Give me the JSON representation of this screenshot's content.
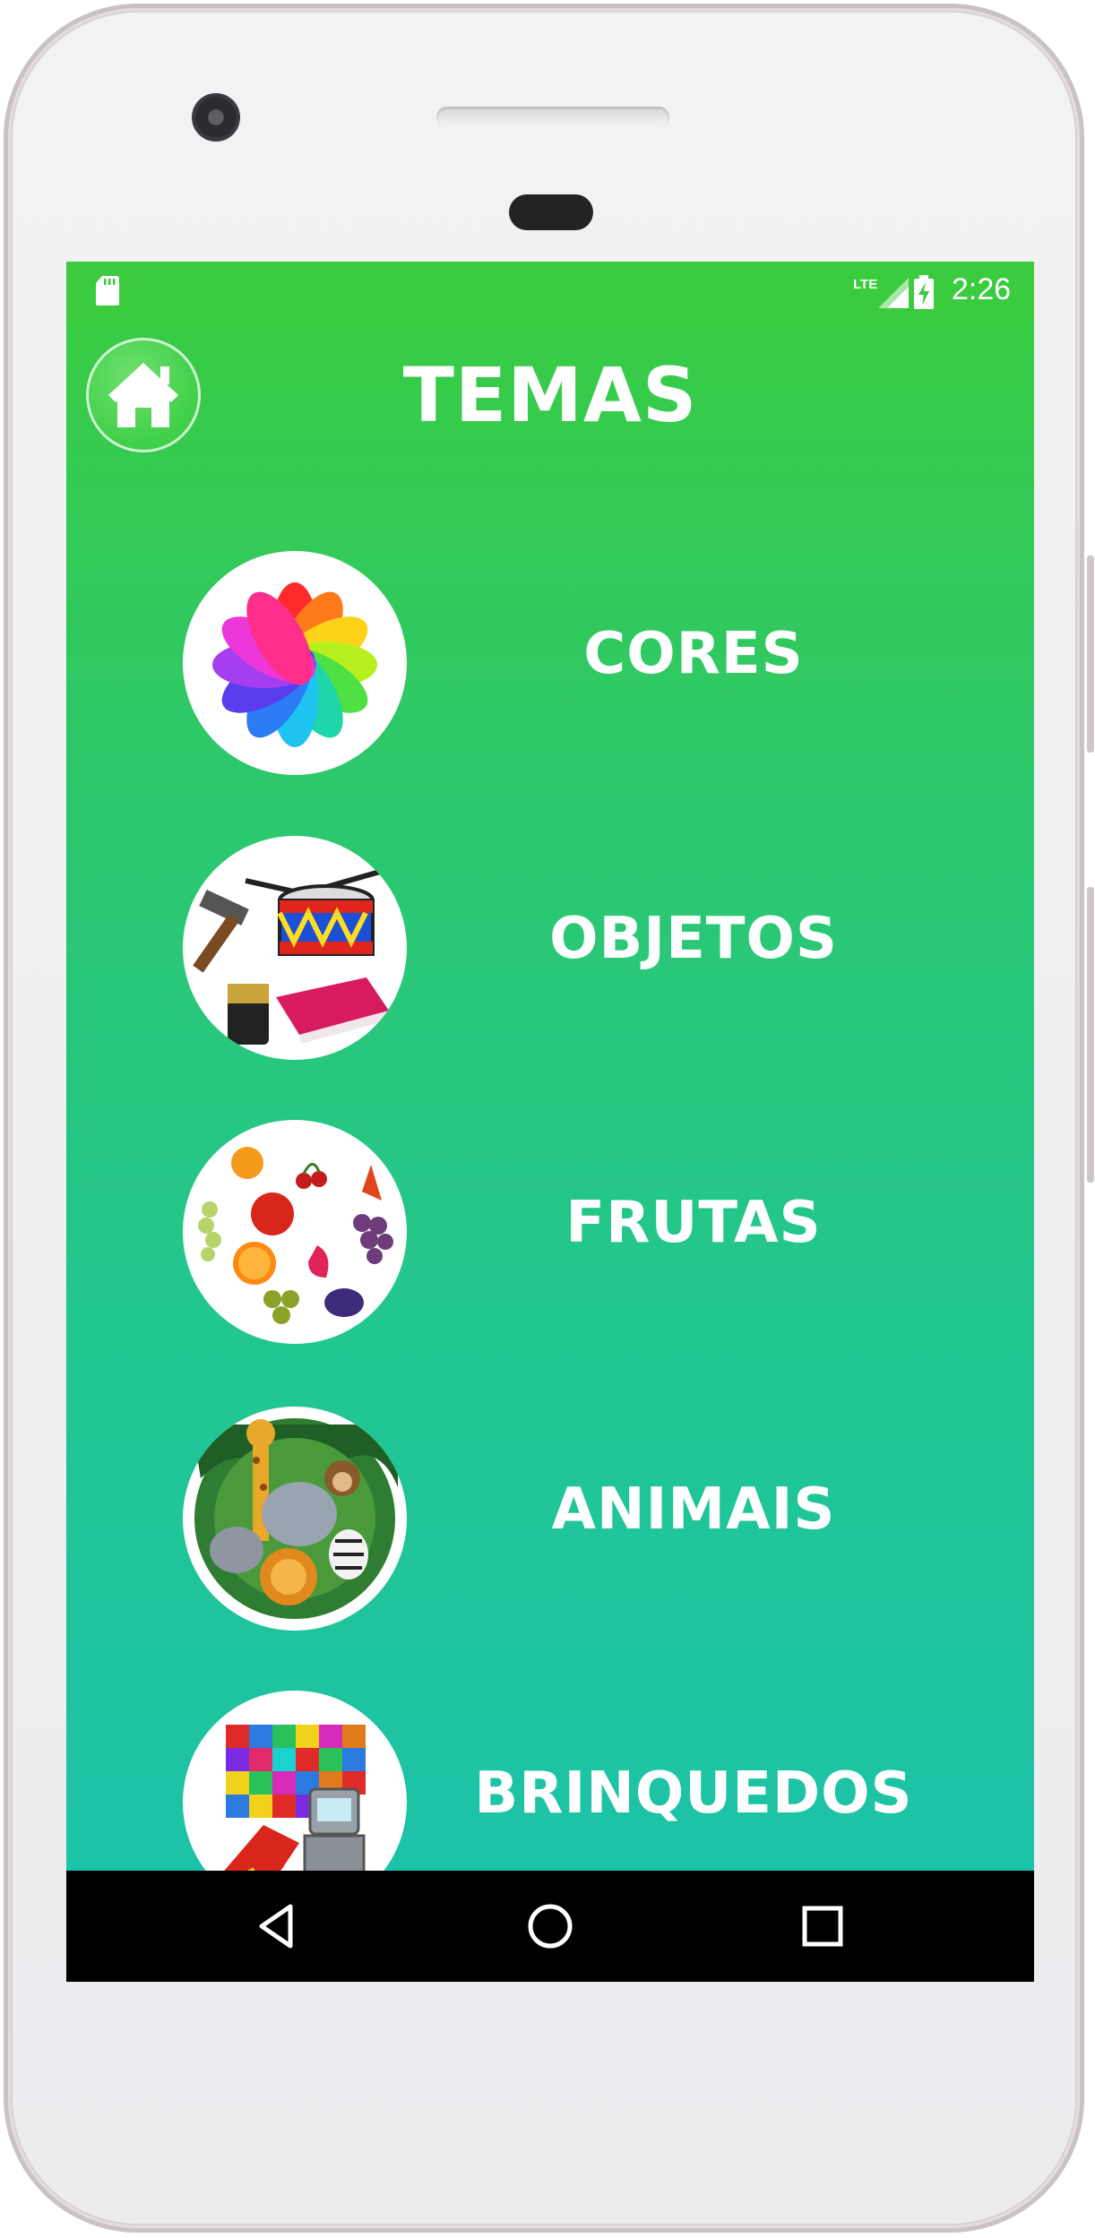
{
  "status_bar": {
    "network": "LTE",
    "time": "2:26"
  },
  "header": {
    "title": "TEMAS"
  },
  "themes": [
    {
      "label": "CORES",
      "image": "color-wheel"
    },
    {
      "label": "OBJETOS",
      "image": "objects-collage"
    },
    {
      "label": "FRUTAS",
      "image": "fruits-collage"
    },
    {
      "label": "ANIMAIS",
      "image": "animals-collage"
    },
    {
      "label": "BRINQUEDOS",
      "image": "toys-collage"
    }
  ],
  "navigation": [
    "back",
    "home",
    "recents"
  ],
  "colors": {
    "gradient_top": "#3acc3f",
    "gradient_bottom": "#1bc2ac",
    "text": "#ffffff",
    "nav_bar": "#000000"
  }
}
